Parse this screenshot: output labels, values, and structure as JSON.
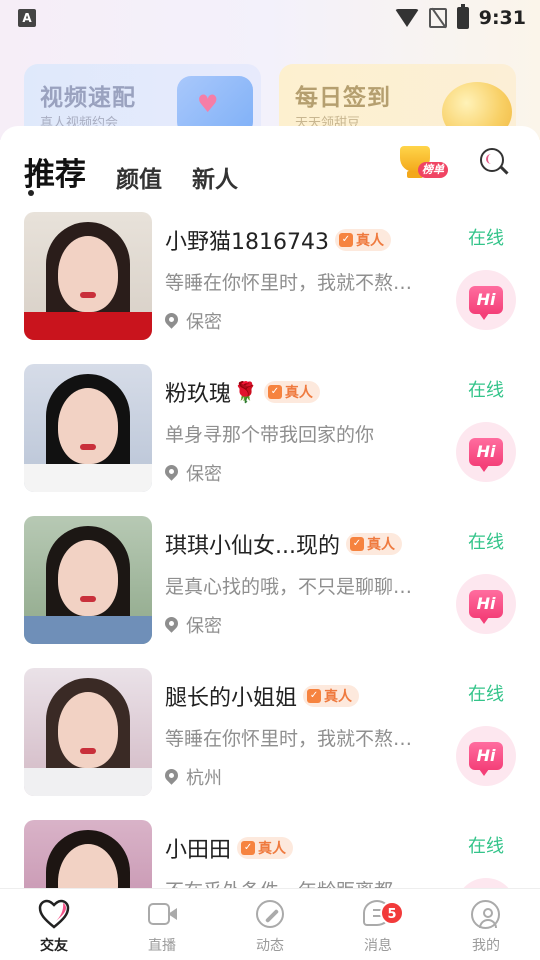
{
  "status_bar": {
    "time": "9:31",
    "app_icon_letter": "A"
  },
  "banners": [
    {
      "title": "视频速配",
      "subtitle": "真人视频约会"
    },
    {
      "title": "每日签到",
      "subtitle": "天天领甜豆"
    }
  ],
  "tabs": [
    {
      "label": "推荐",
      "active": true
    },
    {
      "label": "颜值",
      "active": false
    },
    {
      "label": "新人",
      "active": false
    }
  ],
  "leaderboard_label": "榜单",
  "verified_label": "真人",
  "hi_label": "Hi",
  "users": [
    {
      "name": "小野猫1816743",
      "bio": "等睡在你怀里时，我就不熬夜了",
      "location": "保密",
      "status": "在线",
      "has_rose": false
    },
    {
      "name": "粉玖瑰",
      "bio": "单身寻那个带我回家的你",
      "location": "保密",
      "status": "在线",
      "has_rose": true
    },
    {
      "name": "琪琪小仙女...现的",
      "bio": "是真心找的哦，不只是聊聊天而已",
      "location": "保密",
      "status": "在线",
      "has_rose": false
    },
    {
      "name": "腿长的小姐姐",
      "bio": "等睡在你怀里时，我就不熬夜了",
      "location": "杭州",
      "status": "在线",
      "has_rose": false
    },
    {
      "name": "小田田",
      "bio": "不在乎外条件，年龄距离都",
      "location": "",
      "status": "在线",
      "has_rose": false
    }
  ],
  "bottom_nav": [
    {
      "label": "交友",
      "icon": "heart-icon",
      "active": true
    },
    {
      "label": "直播",
      "icon": "video-icon",
      "active": false
    },
    {
      "label": "动态",
      "icon": "compass-icon",
      "active": false
    },
    {
      "label": "消息",
      "icon": "message-icon",
      "active": false,
      "badge": "5"
    },
    {
      "label": "我的",
      "icon": "profile-icon",
      "active": false
    }
  ],
  "colors": {
    "online": "#34c48a",
    "accent_pink": "#f43f78",
    "verified_orange": "#ef7a3f",
    "badge_red": "#f23b3b"
  }
}
